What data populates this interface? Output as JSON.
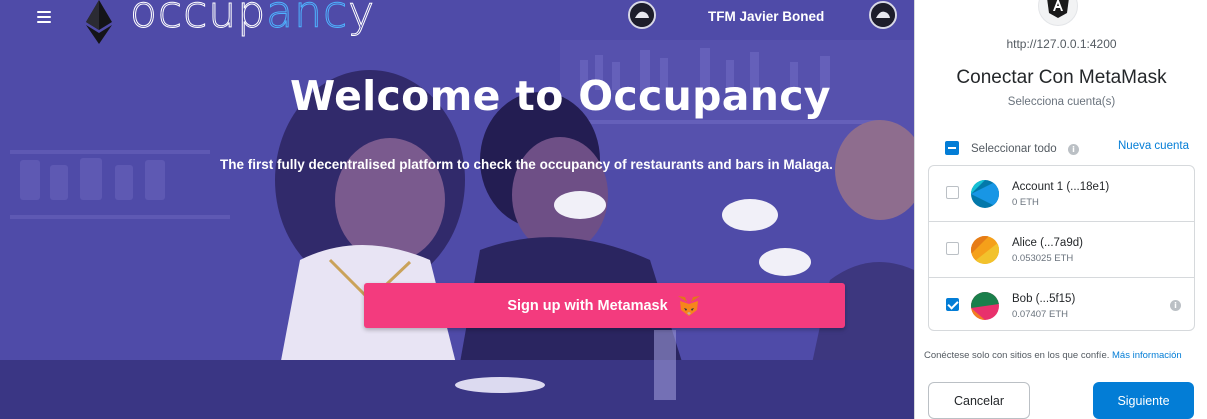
{
  "occupancy": {
    "brand_text": "occupancy",
    "user_name": "TFM Javier Boned",
    "title": "Welcome to Occupancy",
    "subtitle": "The first fully decentralised platform to check the occupancy of restaurants and bars in Malaga.",
    "signup_label": "Sign up with Metamask",
    "colors": {
      "hero_overlay": "#4d49a6",
      "signup_button": "#f33b7e",
      "brand_accent": "#4fb3ff"
    },
    "icons": [
      "menu-icon",
      "ethereum-logo-icon",
      "avatar-icon",
      "metamask-fox-icon"
    ]
  },
  "metamask": {
    "origin": "http://127.0.0.1:4200",
    "title": "Conectar Con MetaMask",
    "subtitle": "Selecciona cuenta(s)",
    "select_all_label": "Seleccionar todo",
    "new_account_label": "Nueva cuenta",
    "accounts": [
      {
        "name": "Account 1 (...18e1)",
        "balance": "0 ETH",
        "checked": false
      },
      {
        "name": "Alice (...7a9d)",
        "balance": "0.053025 ETH",
        "checked": false
      },
      {
        "name": "Bob (...5f15)",
        "balance": "0.07407 ETH",
        "checked": true
      }
    ],
    "footnote_text": "Conéctese solo con sitios en los que confíe.",
    "footnote_link": "Más información",
    "cancel_label": "Cancelar",
    "next_label": "Siguiente",
    "colors": {
      "primary": "#037dd6",
      "text": "#24272a"
    },
    "icons": [
      "angular-icon",
      "info-icon"
    ]
  }
}
